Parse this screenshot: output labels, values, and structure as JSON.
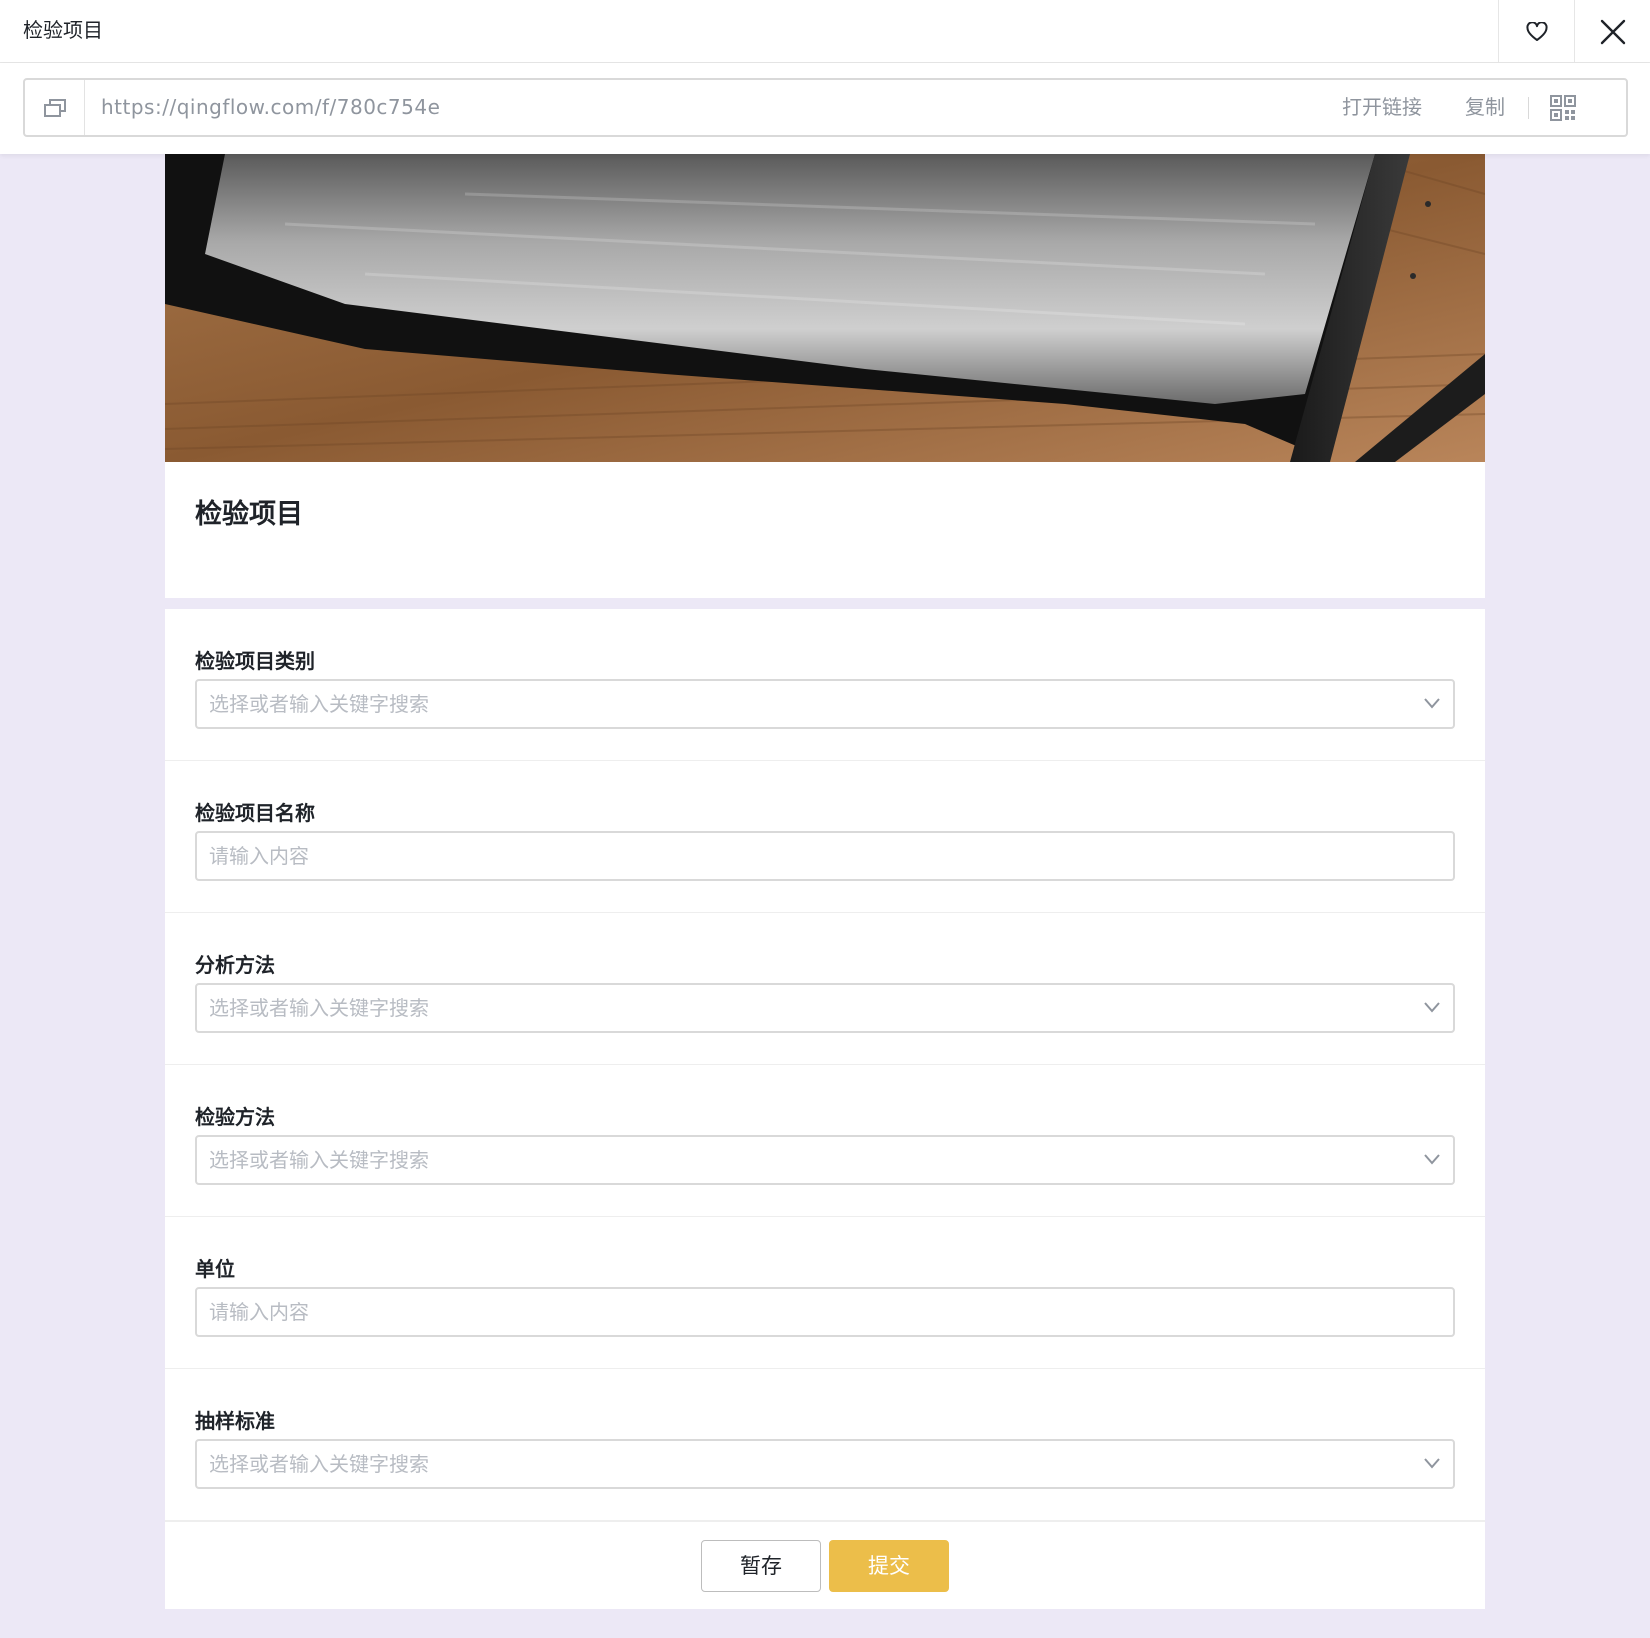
{
  "titlebar": {
    "title": "检验项目",
    "favorite_icon": "heart-icon",
    "close_icon": "close-icon"
  },
  "urlbar": {
    "url": "https://qingflow.com/f/780c754e",
    "open_link_label": "打开链接",
    "copy_label": "复制",
    "copy_icon": "copy-link-icon",
    "qr_icon": "qr-code-icon"
  },
  "form": {
    "title": "检验项目",
    "fields": [
      {
        "label": "检验项目类别",
        "placeholder": "选择或者输入关键字搜索",
        "type": "select"
      },
      {
        "label": "检验项目名称",
        "placeholder": "请输入内容",
        "type": "text"
      },
      {
        "label": "分析方法",
        "placeholder": "选择或者输入关键字搜索",
        "type": "select"
      },
      {
        "label": "检验方法",
        "placeholder": "选择或者输入关键字搜索",
        "type": "select"
      },
      {
        "label": "单位",
        "placeholder": "请输入内容",
        "type": "text"
      },
      {
        "label": "抽样标准",
        "placeholder": "选择或者输入关键字搜索",
        "type": "select"
      }
    ],
    "save_label": "暂存",
    "submit_label": "提交"
  },
  "colors": {
    "accent": "#ecbe4a",
    "page_background": "#ece8f6"
  }
}
